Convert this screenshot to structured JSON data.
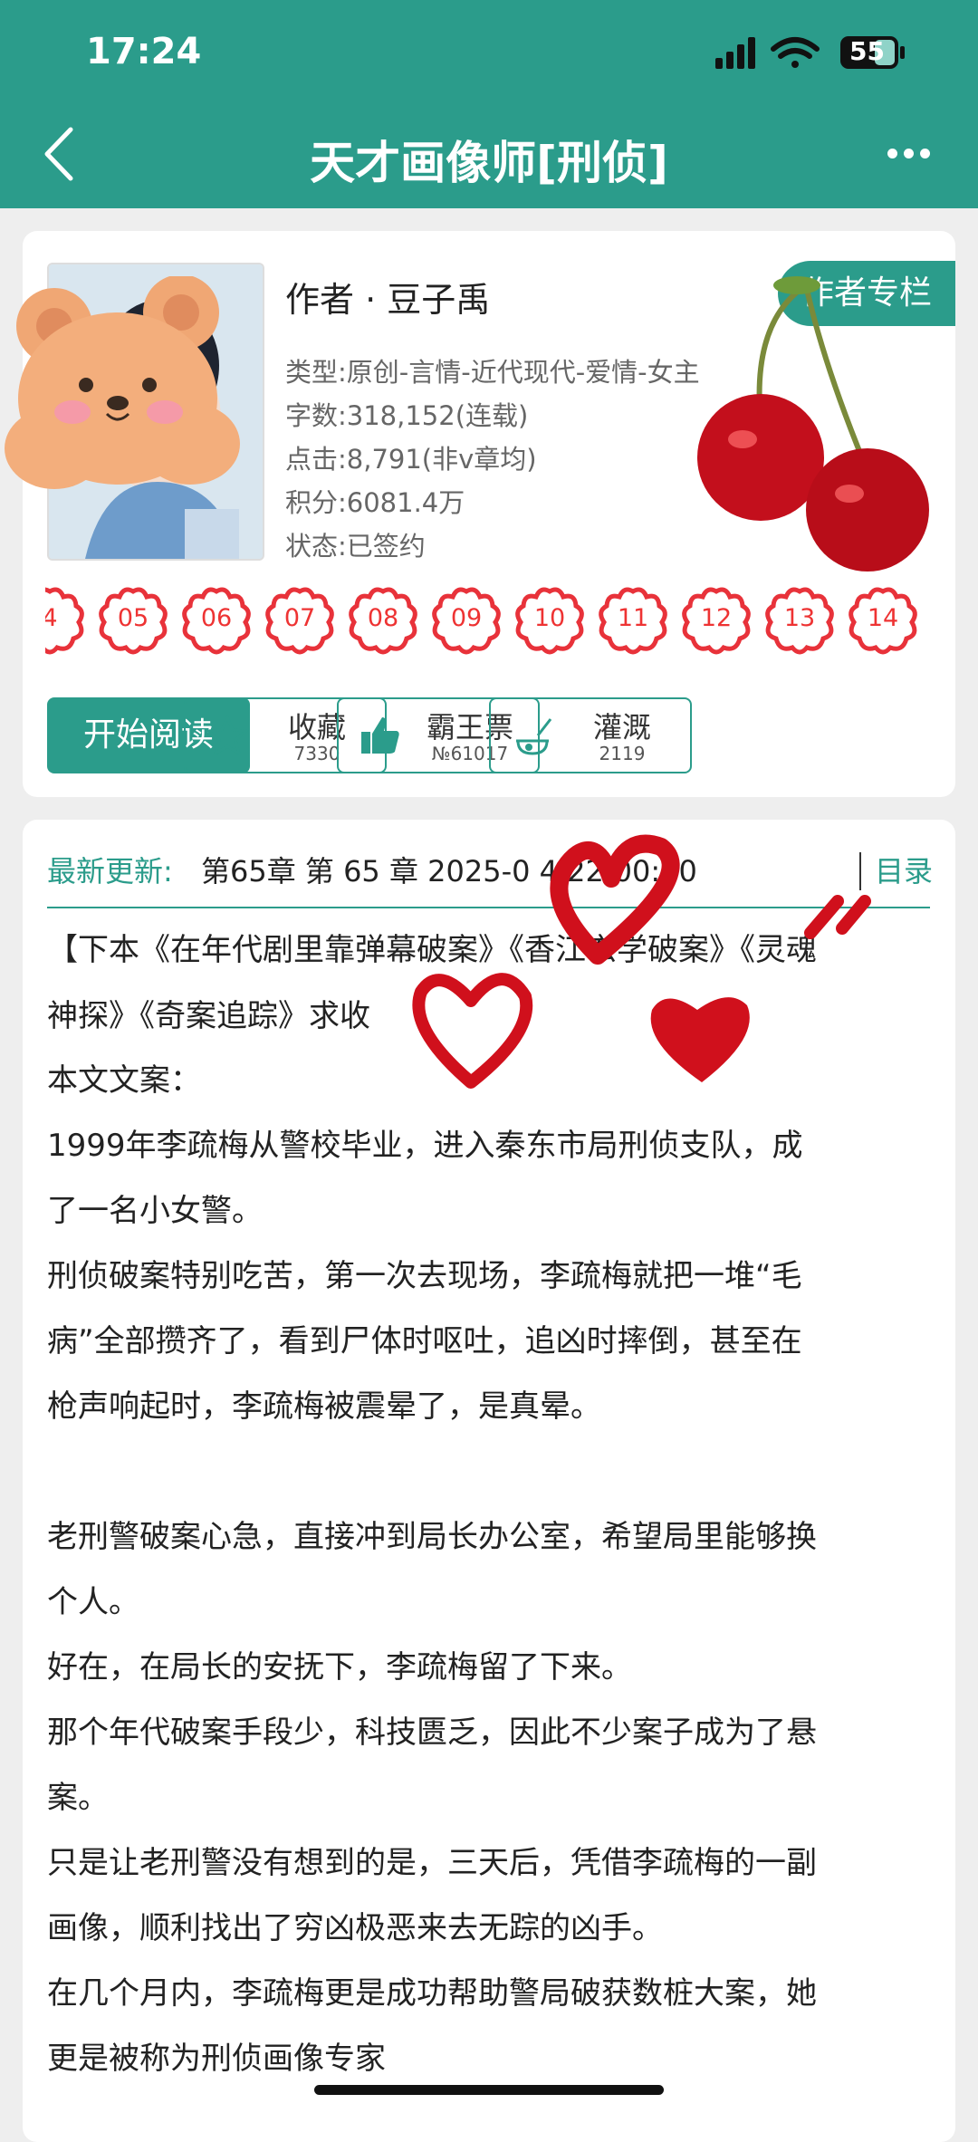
{
  "status_bar": {
    "time": "17:24",
    "battery": "55"
  },
  "nav": {
    "title": "天才画像师[刑侦]"
  },
  "book": {
    "author": "作者 · 豆子禹",
    "author_column": "作者专栏",
    "genre": "类型:原创-言情-近代现代-爱情-女主",
    "word_count": "字数:318,152(连载)",
    "clicks": "点击:8,791(非v章均)",
    "score": "积分:6081.4万",
    "status": "状态:已签约"
  },
  "chapters": [
    "4",
    "05",
    "06",
    "07",
    "08",
    "09",
    "10",
    "11",
    "12",
    "13",
    "14"
  ],
  "actions": {
    "read": "开始阅读",
    "collect": {
      "label": "收藏",
      "count": "7330"
    },
    "ticket": {
      "label": "霸王票",
      "count": "№61017"
    },
    "water": {
      "label": "灌溉",
      "count": "2119"
    }
  },
  "update": {
    "label": "最新更新:",
    "text": "第65章 第 65 章 2025-0 4 22:00:00",
    "toc": "目录"
  },
  "content": [
    "【下本《在年代剧里靠弹幕破案》《香江玄学破案》《灵魂",
    "神探》《奇案追踪》求收",
    "本文文案：",
    "1999年李疏梅从警校毕业，进入秦东市局刑侦支队，成",
    "了一名小女警。",
    "刑侦破案特别吃苦，第一次去现场，李疏梅就把一堆“毛",
    "病”全部攒齐了，看到尸体时呕吐，追凶时摔倒，甚至在",
    "枪声响起时，李疏梅被震晕了，是真晕。",
    "老刑警破案心急，直接冲到局长办公室，希望局里能够换",
    "个人。",
    "好在，在局长的安抚下，李疏梅留了下来。",
    "那个年代破案手段少，科技匮乏，因此不少案子成为了悬",
    "案。",
    "只是让老刑警没有想到的是，三天后，凭借李疏梅的一副",
    "画像，顺利找出了穷凶极恶来去无踪的凶手。",
    "在几个月内，李疏梅更是成功帮助警局破获数桩大案，她",
    "更是被称为刑侦画像专家"
  ]
}
